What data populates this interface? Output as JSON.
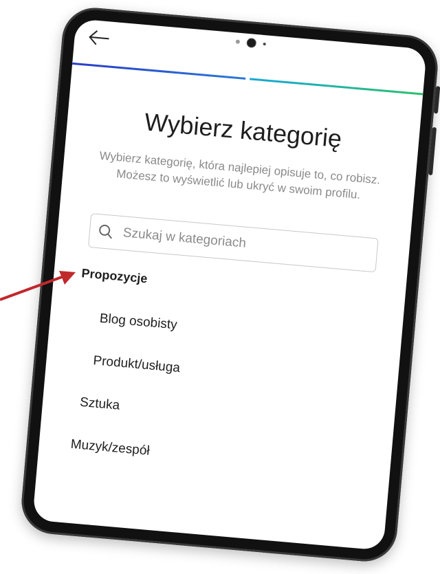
{
  "header": {
    "back_icon": "arrow-left-icon"
  },
  "progress": {
    "steps_total": 2,
    "colors": [
      "#2a3cc8",
      "#2ec06a"
    ]
  },
  "page": {
    "title": "Wybierz kategorię",
    "subtitle": "Wybierz kategorię, która najlepiej opisuje to, co robisz. Możesz to wyświetlić lub ukryć w swoim profilu."
  },
  "search": {
    "placeholder": "Szukaj w kategoriach",
    "value": "",
    "icon": "search-icon"
  },
  "suggestions": {
    "label": "Propozycje",
    "items": [
      {
        "label": "Blog osobisty"
      },
      {
        "label": "Produkt/usługa"
      },
      {
        "label": "Sztuka"
      },
      {
        "label": "Muzyk/zespół"
      }
    ]
  },
  "annotation": {
    "arrow_color": "#c0282c",
    "arrow_icon": "pointer-arrow-icon"
  }
}
